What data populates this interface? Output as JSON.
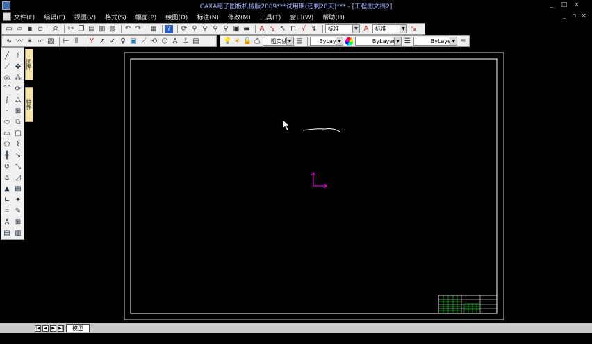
{
  "window": {
    "title": "CAXA电子图板机械版2009***试用期(还剩28天)*** - [工程图文档2]",
    "minimize": "_",
    "maximize": "□",
    "close": "×"
  },
  "menu": [
    "文件(F)",
    "编辑(E)",
    "视图(V)",
    "格式(S)",
    "幅面(P)",
    "绘图(D)",
    "标注(N)",
    "修改(M)",
    "工具(T)",
    "窗口(W)",
    "帮助(H)"
  ],
  "mdi_controls": {
    "minimize": "_",
    "restore": "▫",
    "close": "×"
  },
  "toolbar1": {
    "text_style": "标准",
    "dim_style": "标准"
  },
  "toolbar2": {
    "layer": "粗实线层",
    "color": "ByLayer",
    "linetype": "ByLayer",
    "linewidth": "ByLayer"
  },
  "side_tabs": [
    "图库",
    "特性"
  ],
  "bottom": {
    "nav": [
      "|◀",
      "◀",
      "▶",
      "▶|"
    ],
    "model_tab": "模型"
  },
  "colors": {
    "canvas": "#000000",
    "frame": "#ffffff",
    "ucs": "#d000d0",
    "title_block": "#00ff00"
  }
}
